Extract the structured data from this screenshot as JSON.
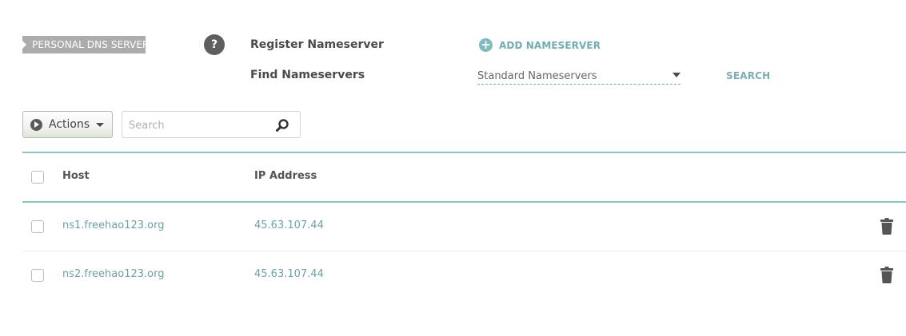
{
  "section_tag": "PERSONAL DNS SERVER",
  "help_icon": "question-icon",
  "register_nameserver_label": "Register Nameserver",
  "add_nameserver_label": "ADD NAMESERVER",
  "find_nameservers_label": "Find Nameservers",
  "find_select_value": "Standard Nameservers",
  "search_link_label": "SEARCH",
  "toolbar": {
    "actions_label": "Actions",
    "search_placeholder": "Search"
  },
  "table": {
    "headers": {
      "host": "Host",
      "ip": "IP Address"
    },
    "rows": [
      {
        "host": "ns1.freehao123.org",
        "ip": "45.63.107.44"
      },
      {
        "host": "ns2.freehao123.org",
        "ip": "45.63.107.44"
      }
    ]
  },
  "colors": {
    "accent_teal": "#6eaeb2",
    "tag_gray": "#acacac",
    "divider_teal": "#8cc3c5"
  }
}
